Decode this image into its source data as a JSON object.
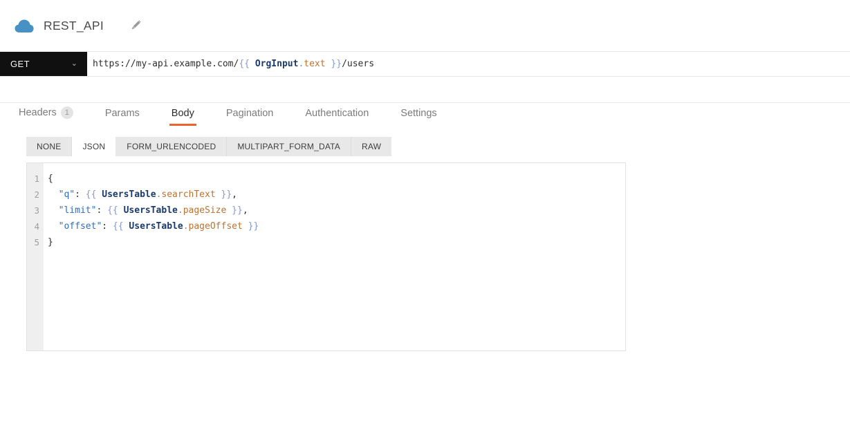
{
  "header": {
    "title": "REST_API"
  },
  "request_bar": {
    "method": "GET",
    "chevron_icon": "chevron-down",
    "url_tokens": [
      {
        "t": "https://my-api.example.com/",
        "c": "plain"
      },
      {
        "t": "{{ ",
        "c": "brace"
      },
      {
        "t": "OrgInput",
        "c": "widget"
      },
      {
        "t": ".",
        "c": "dot"
      },
      {
        "t": "text",
        "c": "property"
      },
      {
        "t": " }}",
        "c": "brace"
      },
      {
        "t": "/users",
        "c": "plain"
      }
    ]
  },
  "tabs": [
    {
      "label": "Headers",
      "badge": "1",
      "active": false
    },
    {
      "label": "Params",
      "active": false
    },
    {
      "label": "Body",
      "active": true
    },
    {
      "label": "Pagination",
      "active": false
    },
    {
      "label": "Authentication",
      "active": false
    },
    {
      "label": "Settings",
      "active": false
    }
  ],
  "body_type_tabs": [
    {
      "label": "NONE",
      "active": false
    },
    {
      "label": "JSON",
      "active": true
    },
    {
      "label": "FORM_URLENCODED",
      "active": false
    },
    {
      "label": "MULTIPART_FORM_DATA",
      "active": false
    },
    {
      "label": "RAW",
      "active": false
    }
  ],
  "editor": {
    "lines": [
      {
        "number": "1",
        "tokens": [
          {
            "t": "{",
            "c": "plain"
          }
        ]
      },
      {
        "number": "2",
        "tokens": [
          {
            "t": "  ",
            "c": "plain"
          },
          {
            "t": "\"q\"",
            "c": "key"
          },
          {
            "t": ": ",
            "c": "plain"
          },
          {
            "t": "{{ ",
            "c": "brace"
          },
          {
            "t": "UsersTable",
            "c": "widget"
          },
          {
            "t": ".",
            "c": "dot"
          },
          {
            "t": "searchText",
            "c": "property"
          },
          {
            "t": " }}",
            "c": "brace"
          },
          {
            "t": ",",
            "c": "plain"
          }
        ]
      },
      {
        "number": "3",
        "tokens": [
          {
            "t": "  ",
            "c": "plain"
          },
          {
            "t": "\"limit\"",
            "c": "key"
          },
          {
            "t": ": ",
            "c": "plain"
          },
          {
            "t": "{{ ",
            "c": "brace"
          },
          {
            "t": "UsersTable",
            "c": "widget"
          },
          {
            "t": ".",
            "c": "dot"
          },
          {
            "t": "pageSize",
            "c": "property"
          },
          {
            "t": " }}",
            "c": "brace"
          },
          {
            "t": ",",
            "c": "plain"
          }
        ]
      },
      {
        "number": "4",
        "tokens": [
          {
            "t": "  ",
            "c": "plain"
          },
          {
            "t": "\"offset\"",
            "c": "key"
          },
          {
            "t": ": ",
            "c": "plain"
          },
          {
            "t": "{{ ",
            "c": "brace"
          },
          {
            "t": "UsersTable",
            "c": "widget"
          },
          {
            "t": ".",
            "c": "dot"
          },
          {
            "t": "pageOffset",
            "c": "property"
          },
          {
            "t": " }}",
            "c": "brace"
          }
        ]
      },
      {
        "number": "5",
        "tokens": [
          {
            "t": "}",
            "c": "plain"
          }
        ]
      }
    ]
  },
  "colors": {
    "accent_orange": "#f0622c",
    "method_bg": "#101010",
    "cloud_blue": "#4791c4",
    "key_blue": "#2e6dc4",
    "brace_blue": "#8499cf",
    "widget_navy": "#1a3a6e",
    "property_orange": "#c1712f",
    "segbar_bg": "#e8e8e8",
    "border_gray": "#e9e9e9"
  },
  "icons": {
    "cloud": "cloud-icon",
    "edit": "pencil-icon"
  }
}
